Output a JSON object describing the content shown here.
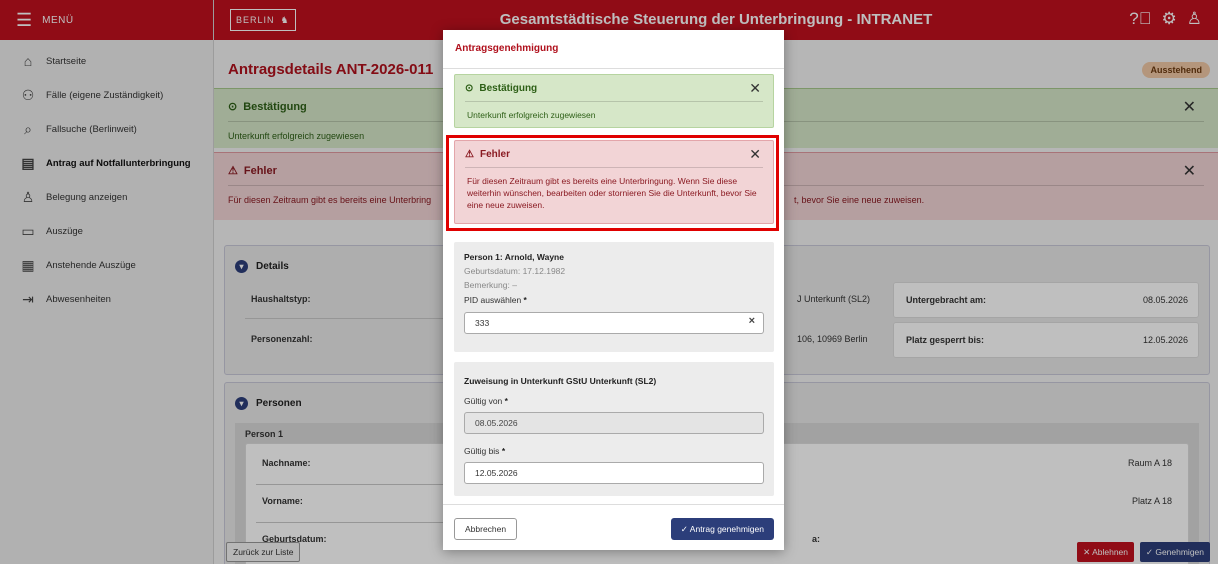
{
  "sidebar": {
    "menu_label": "MENÜ",
    "items": [
      {
        "label": "Startseite",
        "icon": "home-icon"
      },
      {
        "label": "Fälle (eigene Zuständigkeit)",
        "icon": "users-icon"
      },
      {
        "label": "Fallsuche (Berlinweit)",
        "icon": "search-icon"
      },
      {
        "label": "Antrag auf Notfallunterbringung",
        "icon": "form-icon"
      },
      {
        "label": "Belegung anzeigen",
        "icon": "user-check-icon"
      },
      {
        "label": "Auszüge",
        "icon": "building-icon"
      },
      {
        "label": "Anstehende Auszüge",
        "icon": "calendar-icon"
      },
      {
        "label": "Abwesenheiten",
        "icon": "logout-icon"
      }
    ]
  },
  "header": {
    "logo_text": "BERLIN",
    "title": "Gesamtstädtische Steuerung der Unterbringung - INTRANET"
  },
  "page": {
    "title": "Antragsdetails ANT-2026-011",
    "status": "Ausstehend",
    "success_alert": {
      "title": "Bestätigung",
      "body": "Unterkunft erfolgreich zugewiesen"
    },
    "error_alert": {
      "title": "Fehler",
      "body_left": "Für diesen Zeitraum gibt es bereits eine Unterbring",
      "body_right": "t, bevor Sie eine neue zuweisen."
    },
    "details": {
      "heading": "Details",
      "haushaltstyp_label": "Haushaltstyp:",
      "personenzahl_label": "Personenzahl:",
      "unterkunft_partial": "J Unterkunft (SL2)",
      "adresse_partial": "106, 10969 Berlin",
      "untergebracht_label": "Untergebracht am:",
      "untergebracht_value": "08.05.2026",
      "platz_label": "Platz gesperrt bis:",
      "platz_value": "12.05.2026"
    },
    "persons": {
      "heading": "Personen",
      "person_title": "Person 1",
      "nachname_label": "Nachname:",
      "vorname_label": "Vorname:",
      "geburtsdatum_label": "Geburtsdatum:",
      "raum_value": "Raum A 18",
      "platz_value": "Platz A 18",
      "partial_label": "a:"
    },
    "back_button": "Zurück zur Liste",
    "reject_button": "✕ Ablehnen",
    "approve_button": "✓ Genehmigen"
  },
  "modal": {
    "title": "Antragsgenehmigung",
    "success": {
      "title": "Bestätigung",
      "body": "Unterkunft erfolgreich zugewiesen"
    },
    "error": {
      "title": "Fehler",
      "body": "Für diesen Zeitraum gibt es bereits eine Unterbringung. Wenn Sie diese weiterhin wünschen, bearbeiten oder stornieren Sie die Unterkunft, bevor Sie eine neue zuweisen."
    },
    "person": {
      "name": "Person 1: Arnold, Wayne",
      "birth": "Geburtsdatum: 17.12.1982",
      "remark": "Bemerkung: –",
      "pid_label": "PID auswählen",
      "pid_value": "333"
    },
    "assignment": {
      "title": "Zuweisung in Unterkunft GStU Unterkunft (SL2)",
      "from_label": "Gültig von",
      "from_value": "08.05.2026",
      "to_label": "Gültig bis",
      "to_value": "12.05.2026"
    },
    "cancel_button": "Abbrechen",
    "approve_button": "✓ Antrag genehmigen"
  },
  "colors": {
    "brand_red": "#c0101e",
    "navy": "#2c3e7a",
    "success_bg": "#d6e7c8",
    "error_bg": "#f2d4d6"
  }
}
